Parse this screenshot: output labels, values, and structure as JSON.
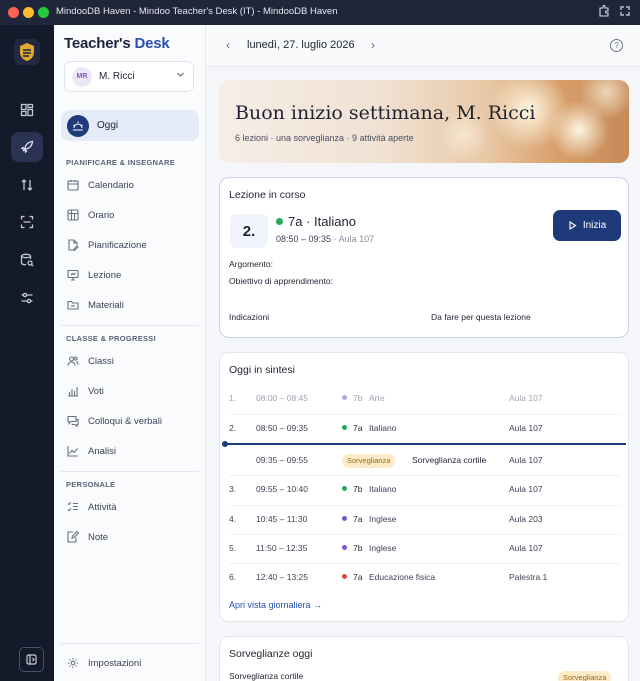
{
  "window": {
    "title": "MindooDB Haven - Mindoo Teacher's Desk (IT) - MindooDB Haven"
  },
  "brand": {
    "part1": "Teacher's",
    "part2": "Desk"
  },
  "user": {
    "initials": "MR",
    "name": "M. Ricci"
  },
  "nav": {
    "today": "Oggi",
    "section1": "PIANIFICARE & INSEGNARE",
    "items1": [
      "Calendario",
      "Orario",
      "Pianificazione",
      "Lezione",
      "Materiali"
    ],
    "section2": "CLASSE & PROGRESSI",
    "items2": [
      "Classi",
      "Voti",
      "Colloqui & verbali",
      "Analisi"
    ],
    "section3": "PERSONALE",
    "items3": [
      "Attività",
      "Note"
    ],
    "settings": "Impostazioni"
  },
  "header": {
    "date": "lunedì, 27. luglio 2026",
    "prev": "‹",
    "next": "›",
    "help": "?"
  },
  "hero": {
    "title": "Buon inizio settimana, M. Ricci",
    "subtitle": "6 lezioni · una sorveglianza · 9 attività aperte"
  },
  "current_lesson": {
    "heading": "Lezione in corso",
    "number": "2.",
    "title": "7a · Italiano",
    "time": "08:50 – 09:35",
    "room": " · Aula 107",
    "start_button": "Inizia",
    "topic_label": "Argomento:",
    "objective_label": "Obiettivo di apprendimento:",
    "notes_label": "Indicazioni",
    "todo_label": "Da fare per questa lezione"
  },
  "summary": {
    "heading": "Oggi in sintesi",
    "rows": [
      {
        "num": "1.",
        "time": "08:00 – 08:45",
        "cls": "7b",
        "subject": "Arte",
        "room": "Aula 107",
        "color": "#b9a3e0",
        "past": true
      },
      {
        "num": "2.",
        "time": "08:50 – 09:35",
        "cls": "7a",
        "subject": "Italiano",
        "room": "Aula 107",
        "color": "#26a65b",
        "past": false
      },
      {
        "num": "",
        "time": "09:35 – 09:55",
        "badge": "Sorveglianza",
        "subject": "Sorveglianza cortile",
        "room": "Aula 107",
        "past": false
      },
      {
        "num": "3.",
        "time": "09:55 – 10:40",
        "cls": "7b",
        "subject": "Italiano",
        "room": "Aula 107",
        "color": "#26a65b",
        "past": false
      },
      {
        "num": "4.",
        "time": "10:45 – 11:30",
        "cls": "7a",
        "subject": "Inglese",
        "room": "Aula 203",
        "color": "#7a55d0",
        "past": false
      },
      {
        "num": "5.",
        "time": "11:50 – 12:35",
        "cls": "7b",
        "subject": "Inglese",
        "room": "Aula 107",
        "color": "#7a55d0",
        "past": false
      },
      {
        "num": "6.",
        "time": "12:40 – 13:25",
        "cls": "7a",
        "subject": "Educazione fisica",
        "room": "Palestra 1",
        "color": "#e0463c",
        "past": false
      }
    ],
    "link": "Apri vista giornaliera →"
  },
  "supervision": {
    "heading": "Sorveglianze oggi",
    "item": "Sorveglianza cortile",
    "badge": "Sorveglianza"
  }
}
